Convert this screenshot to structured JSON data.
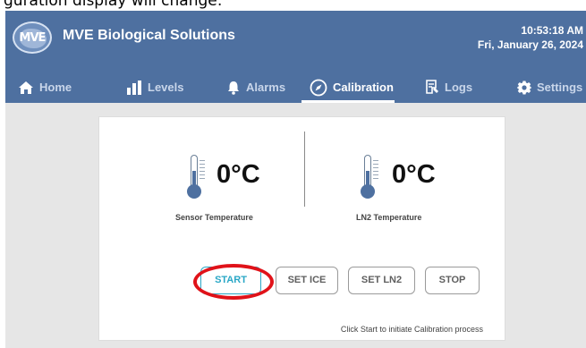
{
  "caption": "guration display will change:",
  "app": {
    "logo_text": "MVE",
    "company": "MVE Biological Solutions",
    "clock": {
      "time": "10:53:18 AM",
      "date": "Fri, January 26, 2024"
    }
  },
  "nav": {
    "items": [
      {
        "label": "Home",
        "icon": "home-icon"
      },
      {
        "label": "Levels",
        "icon": "bars-icon"
      },
      {
        "label": "Alarms",
        "icon": "bell-icon"
      },
      {
        "label": "Calibration",
        "icon": "compass-icon",
        "active": true
      },
      {
        "label": "Logs",
        "icon": "document-icon"
      },
      {
        "label": "Settings",
        "icon": "gear-icon"
      }
    ]
  },
  "calibration": {
    "sensor": {
      "value": "0°C",
      "label": "Sensor Temperature"
    },
    "ln2": {
      "value": "0°C",
      "label": "LN2 Temperature"
    },
    "buttons": {
      "start": "START",
      "set_ice": "SET ICE",
      "set_ln2": "SET LN2",
      "stop": "STOP"
    },
    "hint": "Click Start to initiate Calibration process"
  },
  "colors": {
    "header": "#4e70a0",
    "accent": "#2aa7c6",
    "annotation": "#e01219"
  }
}
